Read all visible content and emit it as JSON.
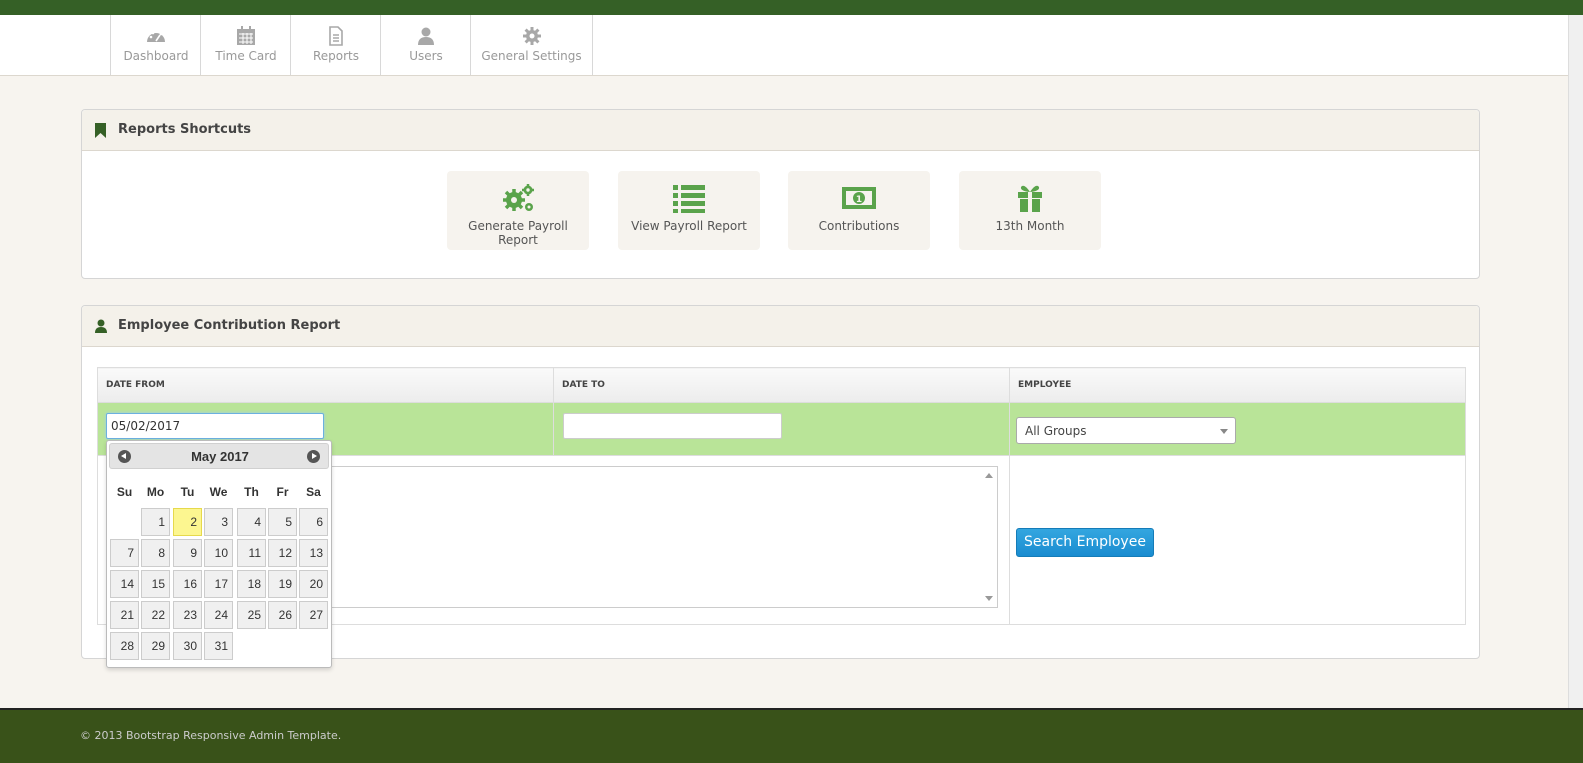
{
  "nav": {
    "items": [
      {
        "label": "Dashboard",
        "icon": "dashboard-icon"
      },
      {
        "label": "Time Card",
        "icon": "calendar-icon"
      },
      {
        "label": "Reports",
        "icon": "document-icon"
      },
      {
        "label": "Users",
        "icon": "user-icon"
      },
      {
        "label": "General Settings",
        "icon": "gear-icon"
      }
    ]
  },
  "shortcuts": {
    "title": "Reports Shortcuts",
    "items": [
      {
        "label": "Generate Payroll Report",
        "icon": "gears-icon"
      },
      {
        "label": "View Payroll Report",
        "icon": "list-icon"
      },
      {
        "label": "Contributions",
        "icon": "money-icon"
      },
      {
        "label": "13th Month",
        "icon": "gift-icon"
      }
    ]
  },
  "report": {
    "title": "Employee Contribution Report",
    "columns": [
      "DATE FROM",
      "DATE TO",
      "EMPLOYEE"
    ],
    "date_from_value": "05/02/2017",
    "date_to_value": "",
    "employee_selected": "All Groups",
    "search_button": "Search Employee"
  },
  "datepicker": {
    "title": "May 2017",
    "dow": [
      "Su",
      "Mo",
      "Tu",
      "We",
      "Th",
      "Fr",
      "Sa"
    ],
    "first_weekday": 1,
    "days_in_month": 31,
    "selected_day": 2
  },
  "footer": {
    "text": "© 2013 Bootstrap Responsive Admin Template."
  },
  "colors": {
    "accent": "#356026",
    "icon_green": "#5aa34b",
    "row_highlight": "#b9e498",
    "button": "#1a8cd0"
  }
}
